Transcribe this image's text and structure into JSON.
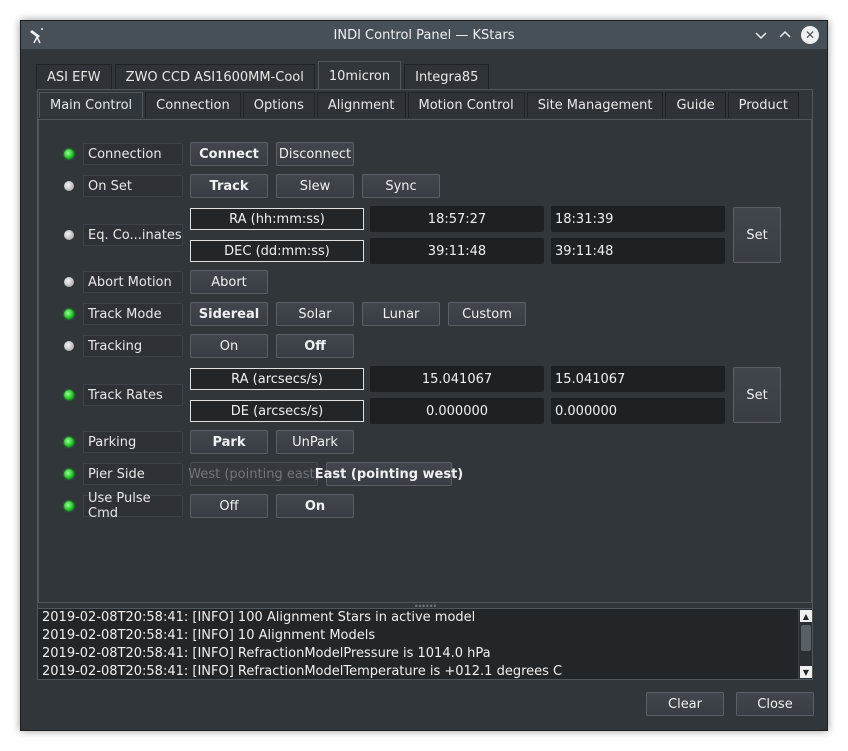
{
  "window": {
    "title": "INDI Control Panel — KStars"
  },
  "device_tabs": [
    {
      "label": "ASI EFW",
      "active": false
    },
    {
      "label": "ZWO CCD ASI1600MM-Cool",
      "active": false
    },
    {
      "label": "10micron",
      "active": true
    },
    {
      "label": "Integra85",
      "active": false
    }
  ],
  "group_tabs": [
    {
      "label": "Main Control",
      "active": true
    },
    {
      "label": "Connection",
      "active": false
    },
    {
      "label": "Options",
      "active": false
    },
    {
      "label": "Alignment",
      "active": false
    },
    {
      "label": "Motion Control",
      "active": false
    },
    {
      "label": "Site Management",
      "active": false
    },
    {
      "label": "Guide",
      "active": false
    },
    {
      "label": "Product",
      "active": false
    }
  ],
  "properties": {
    "connection": {
      "label": "Connection",
      "state": "ok",
      "buttons": [
        "Connect",
        "Disconnect"
      ]
    },
    "on_set": {
      "label": "On Set",
      "state": "idle",
      "buttons": [
        "Track",
        "Slew",
        "Sync"
      ]
    },
    "eq_coords": {
      "label": "Eq. Co...inates",
      "state": "idle",
      "ra": {
        "label": "RA (hh:mm:ss)",
        "value": "18:57:27",
        "target": "18:31:39"
      },
      "dec": {
        "label": "DEC (dd:mm:ss)",
        "value": "39:11:48",
        "target": "39:11:48"
      },
      "set_label": "Set"
    },
    "abort": {
      "label": "Abort Motion",
      "state": "idle",
      "buttons": [
        "Abort"
      ]
    },
    "track_mode": {
      "label": "Track Mode",
      "state": "ok",
      "buttons": [
        "Sidereal",
        "Solar",
        "Lunar",
        "Custom"
      ]
    },
    "tracking": {
      "label": "Tracking",
      "state": "idle",
      "buttons": [
        "On",
        "Off"
      ]
    },
    "track_rates": {
      "label": "Track Rates",
      "state": "ok",
      "ra": {
        "label": "RA (arcsecs/s)",
        "value": "15.041067",
        "target": "15.041067"
      },
      "de": {
        "label": "DE (arcsecs/s)",
        "value": "0.000000",
        "target": "0.000000"
      },
      "set_label": "Set"
    },
    "parking": {
      "label": "Parking",
      "state": "ok",
      "buttons": [
        "Park",
        "UnPark"
      ]
    },
    "pier_side": {
      "label": "Pier Side",
      "state": "ok",
      "buttons": [
        "West (pointing east)",
        "East (pointing west)"
      ]
    },
    "pulse_cmd": {
      "label": "Use Pulse Cmd",
      "state": "ok",
      "buttons": [
        "Off",
        "On"
      ]
    }
  },
  "log": [
    "2019-02-08T20:58:41: [INFO] 100 Alignment Stars in active model",
    "2019-02-08T20:58:41: [INFO] 10 Alignment Models",
    "2019-02-08T20:58:41: [INFO] RefractionModelPressure is 1014.0 hPa",
    "2019-02-08T20:58:41: [INFO] RefractionModelTemperature is +012.1 degrees C"
  ],
  "footer": {
    "clear_label": "Clear",
    "close_label": "Close"
  },
  "colors": {
    "ok": "#18c018",
    "idle": "#bdbdbd",
    "background": "#31363b"
  }
}
